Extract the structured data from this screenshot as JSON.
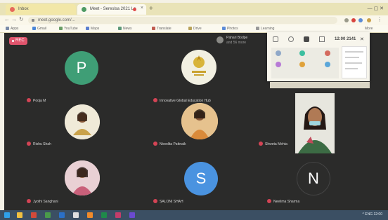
{
  "browser": {
    "tabs": [
      {
        "title": "Inbox",
        "active": false
      },
      {
        "title": "Meet - Sereslsa 2021 Le",
        "active": true,
        "recording": true
      }
    ],
    "new_tab_label": "+",
    "address": "meet.google.com/...",
    "bookmarks": [
      "Apps",
      "Gmail",
      "YouTube",
      "Maps",
      "News",
      "Translate",
      "Drive",
      "Photos",
      "Learning",
      "More"
    ],
    "bookmark_colors": [
      "#7a8ba8",
      "#4a86d8",
      "#6a9e66",
      "#5b7fd0",
      "#5e9a7a",
      "#c05c50",
      "#b9a35a",
      "#5c8bd8"
    ]
  },
  "meeting": {
    "timer_label": "REC",
    "host": {
      "name": "Pahari Bodpe",
      "sub": "and 56 more"
    },
    "participants": [
      {
        "name": "Pooja M",
        "type": "letter",
        "letter": "P",
        "color": "#3f9e76"
      },
      {
        "name": "Innovative Global Education Hub",
        "type": "logo",
        "color": "#f2f0e2"
      },
      {
        "name": "Rishu Shah",
        "type": "photo",
        "color": "#caa24a"
      },
      {
        "name": "Nivedita Pattnaik",
        "type": "photo",
        "color": "#d98a3a"
      },
      {
        "name": "Shweta Mehta",
        "type": "self"
      },
      {
        "name": "Jyothi Sanghani",
        "type": "photo",
        "color": "#c9607a"
      },
      {
        "name": "SALONI SHAH",
        "type": "letter",
        "letter": "S",
        "color": "#4a93e0"
      },
      {
        "name": "Neelima Sharma",
        "type": "letter",
        "letter": "N",
        "color": "#2c2c2b"
      }
    ],
    "popup": {
      "time": "12:00 2141",
      "dot_colors": [
        "#8fa8c8",
        "#3cbfa0",
        "#d46a5e",
        "#b77ad6",
        "#e0a23a",
        "#5aa6d9"
      ]
    }
  },
  "taskbar": {
    "icon_colors": [
      "#2fa0e8",
      "#f0c040",
      "#d24a3a",
      "#4a9a4a",
      "#2a70c8",
      "#e0e0e0",
      "#f08a2a",
      "#1f8a4a",
      "#c43d6a",
      "#6a4ad0"
    ],
    "tray": "^ ENG 12:00"
  }
}
